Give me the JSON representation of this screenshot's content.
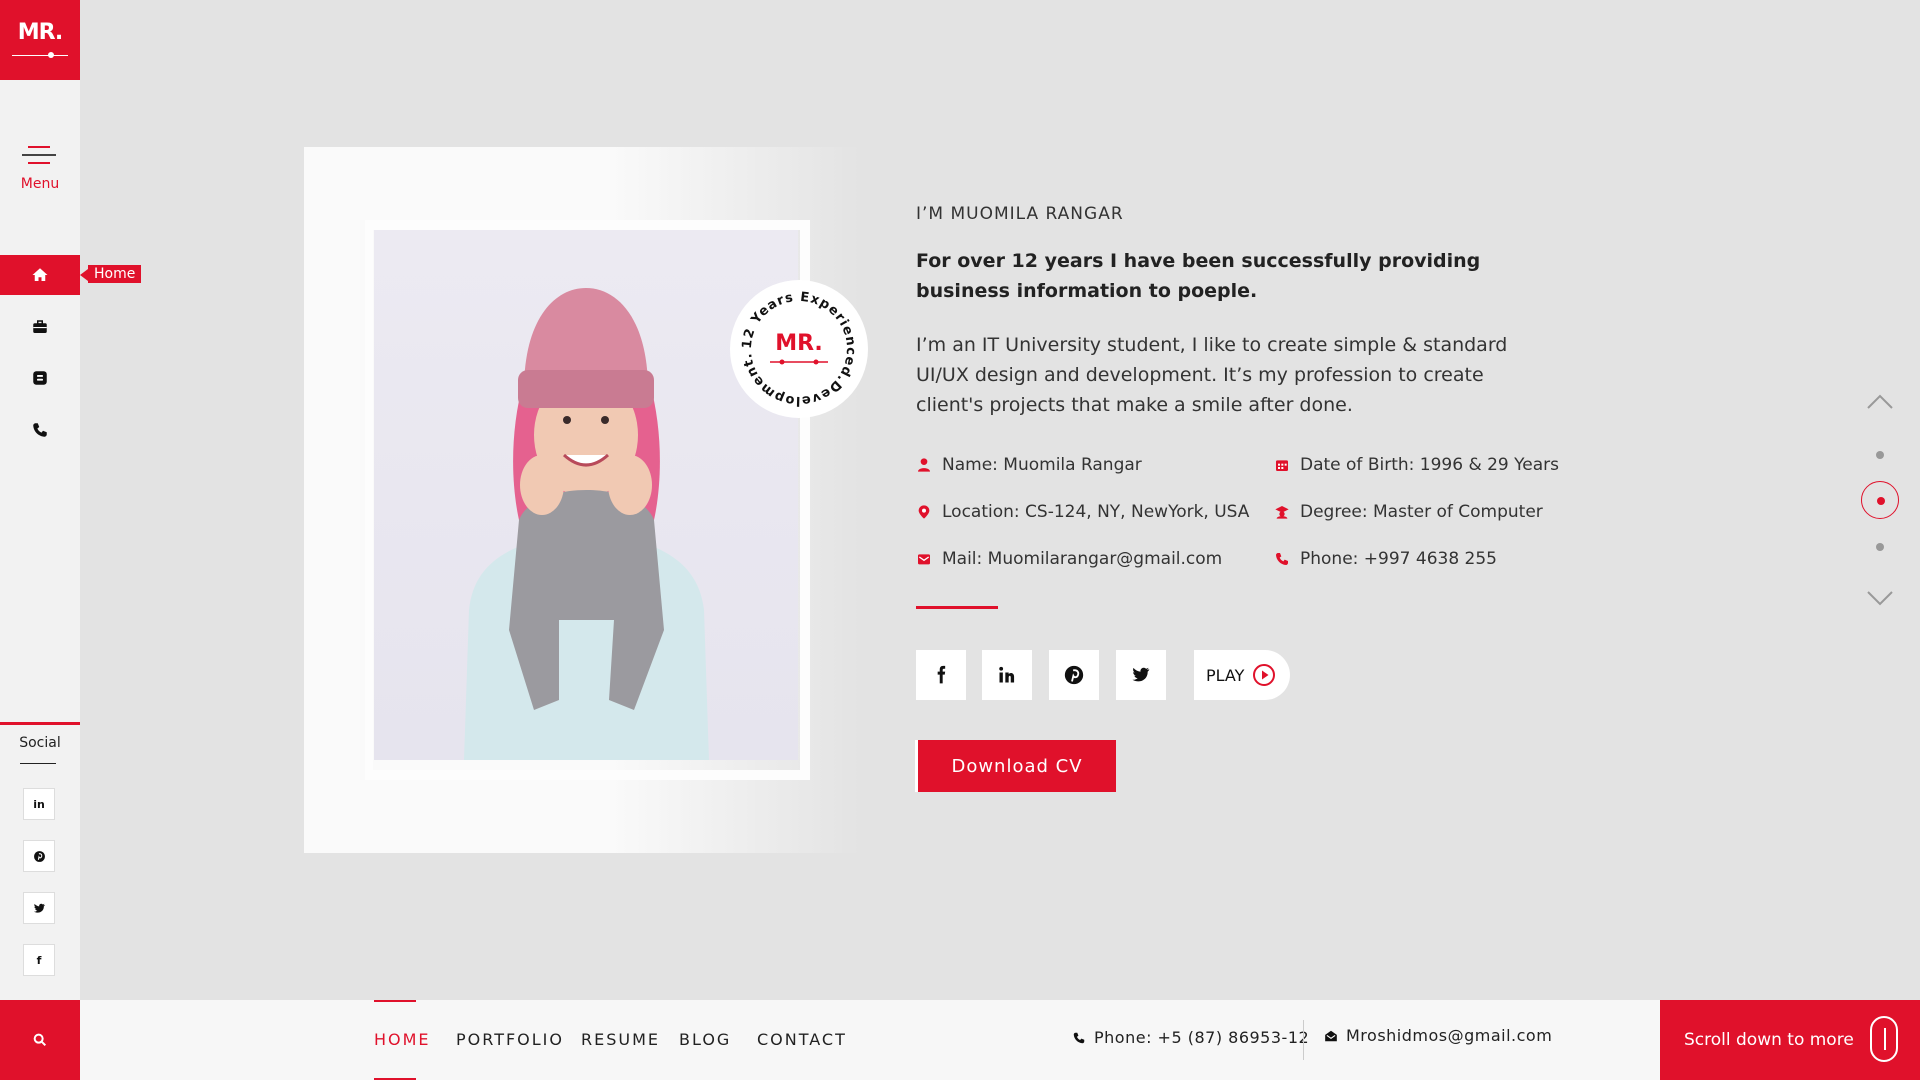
{
  "brand": {
    "logo_text": "MR.",
    "accent": "#e0112b"
  },
  "sidebar": {
    "menu_label": "Menu",
    "items": [
      {
        "icon": "home-icon",
        "tooltip": "Home",
        "active": true
      },
      {
        "icon": "briefcase-icon"
      },
      {
        "icon": "blog-icon"
      },
      {
        "icon": "phone-icon"
      }
    ],
    "social_label": "Social",
    "social": [
      {
        "icon": "linkedin-icon",
        "glyph": "in"
      },
      {
        "icon": "pinterest-icon",
        "glyph": "P"
      },
      {
        "icon": "twitter-icon",
        "glyph": "t"
      },
      {
        "icon": "facebook-icon",
        "glyph": "f"
      }
    ]
  },
  "hero": {
    "badge_center": "MR.",
    "badge_ring_text": "12 Years Experienced.Development.",
    "intro": "I’M MUOMILA RANGAR",
    "headline": "For over 12 years I have been successfully providing business information to poeple.",
    "description": "I’m an IT University student, I like to create simple & standard UI/UX design and development. It’s my profession to create client's projects that make a smile after done.",
    "info": {
      "name": "Name: Muomila Rangar",
      "location": "Location: CS-124, NY, NewYork, USA",
      "mail": "Mail: Muomilarangar@gmail.com",
      "dob": "Date of Birth: 1996 & 29 Years",
      "degree": "Degree: Master of Computer",
      "phone": "Phone: +997 4638 255"
    },
    "play_label": "PLAY",
    "download_label": "Download CV"
  },
  "footer": {
    "nav": [
      "HOME",
      "PORTFOLIO",
      "RESUME",
      "BLOG",
      "CONTACT"
    ],
    "active": "HOME",
    "phone": "Phone: +5 (87) 86953-12",
    "email": "Mroshidmos@gmail.com",
    "scroll_label": "Scroll down to more"
  }
}
